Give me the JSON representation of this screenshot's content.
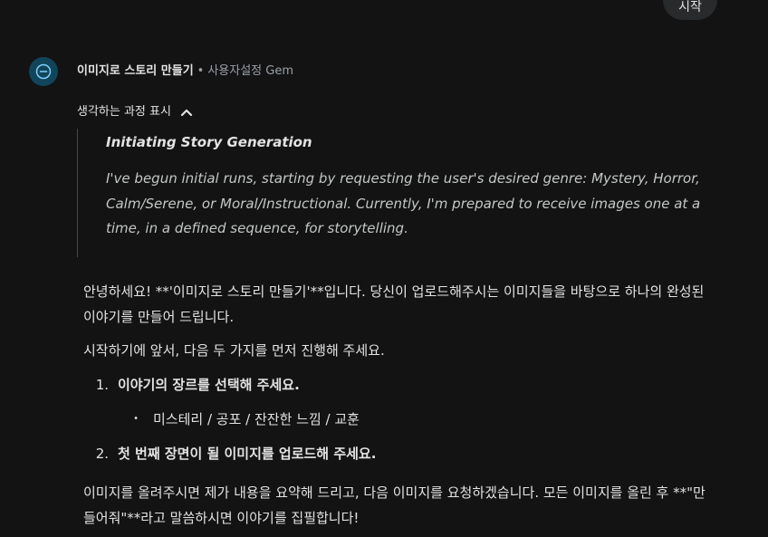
{
  "user_message": {
    "text": "시작"
  },
  "header": {
    "gem_title": "이미지로 스토리 만들기",
    "separator": "•",
    "gem_meta": "사용자설정 Gem"
  },
  "thinking": {
    "toggle_label": "생각하는 과정 표시",
    "title": "Initiating Story Generation",
    "body": "I've begun initial runs, starting by requesting the user's desired genre: Mystery, Horror, Calm/Serene, or Moral/Instructional. Currently, I'm prepared to receive images one at a time, in a defined sequence, for storytelling."
  },
  "response": {
    "intro": "안녕하세요! **'이미지로 스토리 만들기'**입니다. 당신이 업로드해주시는 이미지들을 바탕으로 하나의 완성된 이야기를 만들어 드립니다.",
    "lead": "시작하기에 앞서, 다음 두 가지를 먼저 진행해 주세요.",
    "steps": [
      {
        "num": "1.",
        "text": "이야기의 장르를 선택해 주세요."
      },
      {
        "num": "2.",
        "text": "첫 번째 장면이 될 이미지를 업로드해 주세요."
      }
    ],
    "genre_options": "미스테리 / 공포 / 잔잔한 느낌 / 교훈",
    "bullet": "•",
    "outro": "이미지를 올려주시면 제가 내용을 요약해 드리고, 다음 이미지를 요청하겠습니다. 모든 이미지를 올린 후 **\"만들어줘\"**라고 말씀하시면 이야기를 집필합니다!"
  },
  "colors": {
    "background": "#131314",
    "avatar_bg": "#11455a",
    "avatar_icon": "#7fcfff",
    "text_primary": "#e3e3e3",
    "text_secondary": "#9aa0a6"
  }
}
